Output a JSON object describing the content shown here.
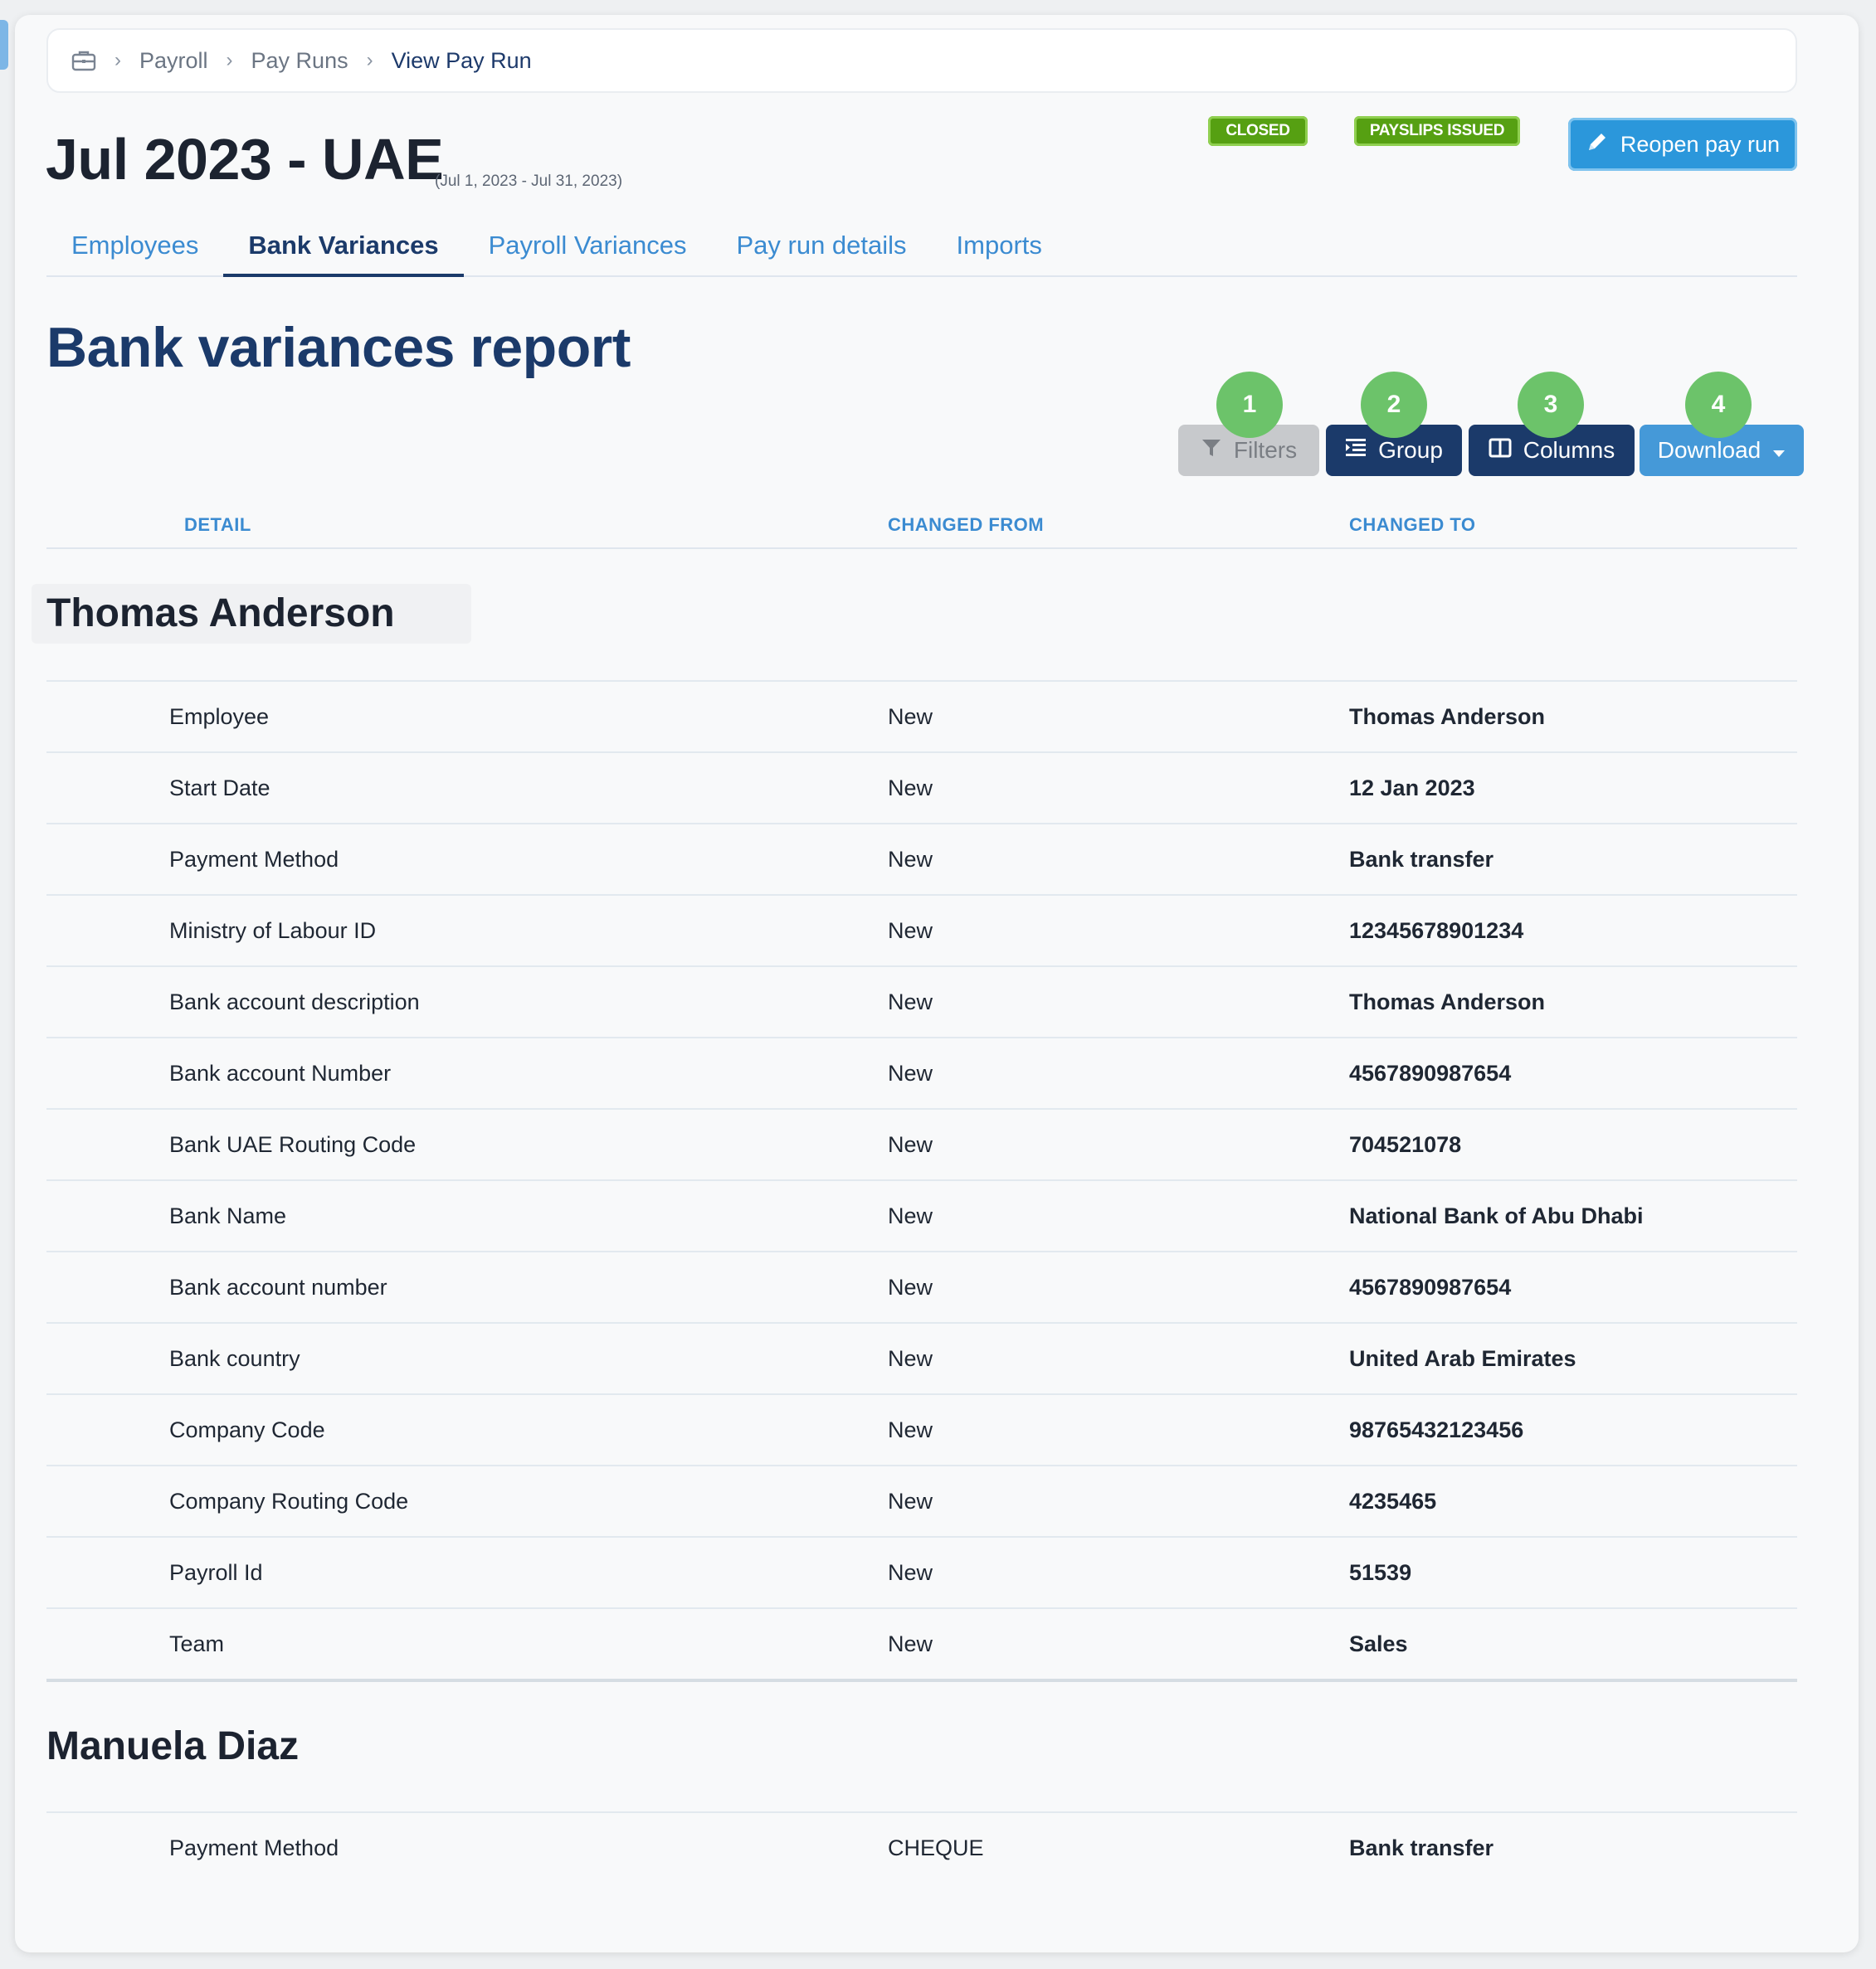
{
  "breadcrumb": {
    "icon": "briefcase-icon",
    "items": [
      "Payroll",
      "Pay Runs",
      "View Pay Run"
    ]
  },
  "header": {
    "title": "Jul 2023 - UAE",
    "date_range": "(Jul 1, 2023 - Jul 31, 2023)",
    "badges": [
      "CLOSED",
      "PAYSLIPS ISSUED"
    ],
    "reopen_label": "Reopen pay run"
  },
  "tabs": [
    "Employees",
    "Bank Variances",
    "Payroll Variances",
    "Pay run details",
    "Imports"
  ],
  "active_tab": "Bank Variances",
  "report": {
    "title": "Bank variances report",
    "toolbar": {
      "filters": "Filters",
      "group": "Group",
      "columns": "Columns",
      "download": "Download"
    },
    "markers": [
      "1",
      "2",
      "3",
      "4"
    ],
    "columns": [
      "DETAIL",
      "CHANGED FROM",
      "CHANGED TO"
    ],
    "employees": [
      {
        "name": "Thomas Anderson",
        "rows": [
          {
            "detail": "Employee",
            "from": "New",
            "to": "Thomas Anderson"
          },
          {
            "detail": "Start Date",
            "from": "New",
            "to": "12 Jan 2023"
          },
          {
            "detail": "Payment Method",
            "from": "New",
            "to": "Bank transfer"
          },
          {
            "detail": "Ministry of Labour ID",
            "from": "New",
            "to": "12345678901234"
          },
          {
            "detail": "Bank account description",
            "from": "New",
            "to": "Thomas Anderson"
          },
          {
            "detail": "Bank account Number",
            "from": "New",
            "to": "4567890987654"
          },
          {
            "detail": "Bank UAE Routing Code",
            "from": "New",
            "to": "704521078"
          },
          {
            "detail": "Bank Name",
            "from": "New",
            "to": "National Bank of Abu Dhabi"
          },
          {
            "detail": "Bank account number",
            "from": "New",
            "to": "4567890987654"
          },
          {
            "detail": "Bank country",
            "from": "New",
            "to": "United Arab Emirates"
          },
          {
            "detail": "Company Code",
            "from": "New",
            "to": "98765432123456"
          },
          {
            "detail": "Company Routing Code",
            "from": "New",
            "to": "4235465"
          },
          {
            "detail": "Payroll Id",
            "from": "New",
            "to": "51539"
          },
          {
            "detail": "Team",
            "from": "New",
            "to": "Sales"
          }
        ]
      },
      {
        "name": "Manuela Diaz",
        "rows": [
          {
            "detail": "Payment Method",
            "from": "CHEQUE",
            "to": "Bank transfer"
          }
        ]
      }
    ]
  },
  "colors": {
    "navy": "#1b3a6a",
    "blue": "#3b8bd1",
    "green_badge": "#56a012",
    "marker_green": "#6cc36a",
    "reopen_blue": "#2b97db"
  }
}
